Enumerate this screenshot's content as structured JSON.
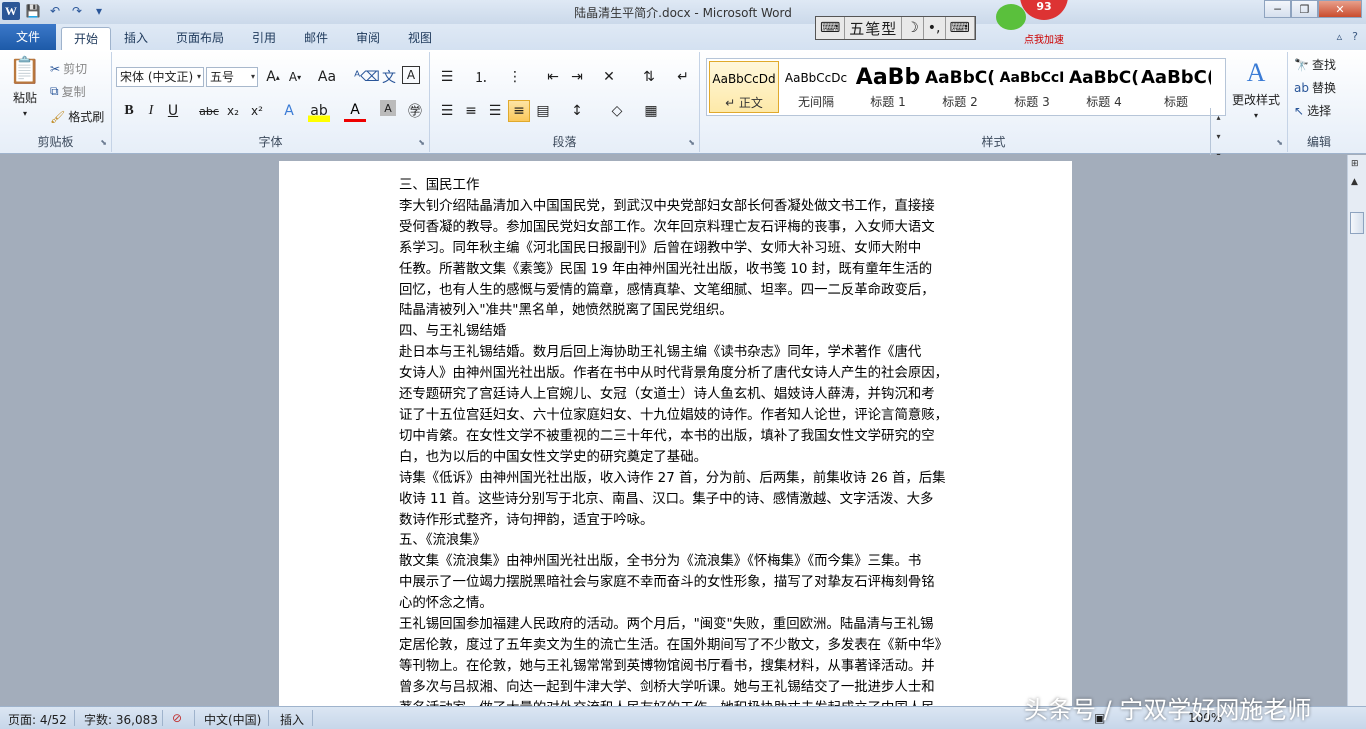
{
  "app": {
    "title": "陆晶清生平简介.docx - Microsoft Word"
  },
  "qat": {
    "word_logo": "W",
    "save": "💾",
    "undo": "↶",
    "redo": "↷",
    "customize": "▾"
  },
  "window_buttons": {
    "minimize": "─",
    "restore": "❐",
    "close": "✕"
  },
  "ime": {
    "logo": "⌨",
    "mode": "五笔型",
    "moon": "☽",
    "punct": "•,",
    "keyboard": "⌨"
  },
  "speedball": {
    "value": "93",
    "label": "点我加速"
  },
  "tabs": [
    {
      "label": "文件"
    },
    {
      "label": "开始"
    },
    {
      "label": "插入"
    },
    {
      "label": "页面布局"
    },
    {
      "label": "引用"
    },
    {
      "label": "邮件"
    },
    {
      "label": "审阅"
    },
    {
      "label": "视图"
    }
  ],
  "ribbon": {
    "clipboard": {
      "paste": "粘贴",
      "cut": "剪切",
      "copy": "复制",
      "format_painter": "格式刷",
      "label": "剪贴板"
    },
    "font": {
      "name": "宋体 (中文正)",
      "size": "五号",
      "label": "字体"
    },
    "paragraph": {
      "label": "段落"
    },
    "styles": {
      "label": "样式",
      "items": [
        {
          "preview": "AaBbCcDd",
          "name": "↵ 正文"
        },
        {
          "preview": "AaBbCcDc",
          "name": "无间隔"
        },
        {
          "preview": "AaBb",
          "name": "标题 1"
        },
        {
          "preview": "AaBbC(",
          "name": "标题 2"
        },
        {
          "preview": "AaBbCcI",
          "name": "标题 3"
        },
        {
          "preview": "AaBbC(",
          "name": "标题 4"
        },
        {
          "preview": "AaBbC(",
          "name": "标题"
        }
      ],
      "change": "更改样式"
    },
    "editing": {
      "find": "查找",
      "replace": "替换",
      "select": "选择",
      "label": "编辑"
    }
  },
  "document": {
    "lines": [
      "三、国民工作",
      "李大钊介绍陆晶清加入中国国民党，到武汉中央党部妇女部长何香凝处做文书工作，直接接",
      "受何香凝的教导。参加国民党妇女部工作。次年回京料理亡友石评梅的丧事，入女师大语文",
      "系学习。同年秋主编《河北国民日报副刊》后曾在翊教中学、女师大补习班、女师大附中",
      "任教。所著散文集《素笺》民国 19 年由神州国光社出版，收书笺 10 封，既有童年生活的",
      "回忆，也有人生的感慨与爱情的篇章，感情真挚、文笔细腻、坦率。四一二反革命政变后，",
      "陆晶清被列入\"准共\"黑名单，她愤然脱离了国民党组织。",
      "四、与王礼锡结婚",
      "赴日本与王礼锡结婚。数月后回上海协助王礼锡主编《读书杂志》同年，学术著作《唐代",
      "女诗人》由神州国光社出版。作者在书中从时代背景角度分析了唐代女诗人产生的社会原因，",
      "还专题研究了宫廷诗人上官婉儿、女冠（女道士）诗人鱼玄机、娼妓诗人薛涛，并钩沉和考",
      "证了十五位宫廷妇女、六十位家庭妇女、十九位娼妓的诗作。作者知人论世，评论言简意赅，",
      "切中肯綮。在女性文学不被重视的二三十年代，本书的出版，填补了我国女性文学研究的空",
      "白，也为以后的中国女性文学史的研究奠定了基础。",
      "诗集《低诉》由神州国光社出版，收入诗作 27 首，分为前、后两集，前集收诗 26 首，后集",
      "收诗 11 首。这些诗分别写于北京、南昌、汉口。集子中的诗、感情激越、文字活泼、大多",
      "数诗作形式整齐，诗句押韵，适宜于吟咏。",
      "五、《流浪集》",
      "散文集《流浪集》由神州国光社出版，全书分为《流浪集》《怀梅集》《而今集》三集。书",
      "中展示了一位竭力摆脱黑暗社会与家庭不幸而奋斗的女性形象，描写了对挚友石评梅刻骨铭",
      "心的怀念之情。",
      "王礼锡回国参加福建人民政府的活动。两个月后，\"闽变\"失败，重回欧洲。陆晶清与王礼锡",
      "定居伦敦，度过了五年卖文为生的流亡生活。在国外期间写了不少散文，多发表在《新中华》",
      "等刊物上。在伦敦，她与王礼锡常常到英博物馆阅书厅看书，搜集材料，从事著译活动。并",
      "曾多次与吕叔湘、向达一起到牛津大学、剑桥大学听课。她与王礼锡结交了一批进步人士和",
      "著名活动家，做了大量的对外交流和人民友好的工作。她积极协助丈夫发起成立了中国人民"
    ]
  },
  "status": {
    "page": "页面: 4/52",
    "words": "字数: 36,083",
    "lang": "中文(中国)",
    "mode": "插入",
    "zoom": "100%"
  },
  "watermark": "头条号 / 宁双学好网施老师"
}
